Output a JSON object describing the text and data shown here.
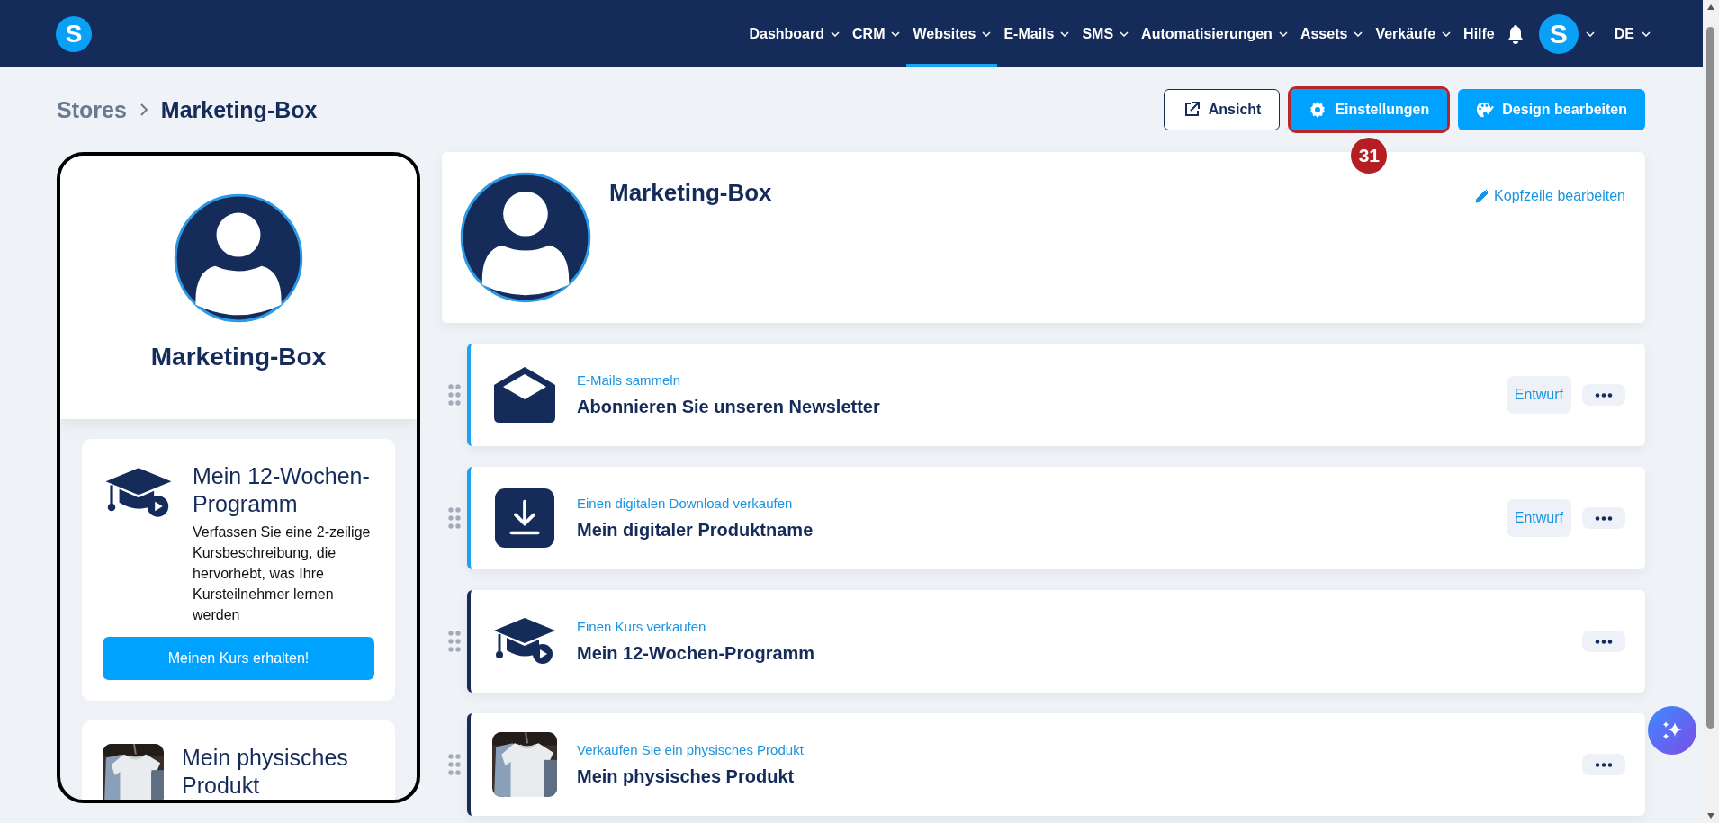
{
  "nav": {
    "logo": "S",
    "items": [
      {
        "label": "Dashboard",
        "dropdown": true,
        "selected": false
      },
      {
        "label": "CRM",
        "dropdown": true,
        "selected": false
      },
      {
        "label": "Websites",
        "dropdown": true,
        "selected": true
      },
      {
        "label": "E-Mails",
        "dropdown": true,
        "selected": false
      },
      {
        "label": "SMS",
        "dropdown": true,
        "selected": false
      },
      {
        "label": "Automatisierungen",
        "dropdown": true,
        "selected": false
      },
      {
        "label": "Assets",
        "dropdown": true,
        "selected": false
      },
      {
        "label": "Verkäufe",
        "dropdown": true,
        "selected": false
      },
      {
        "label": "Hilfe",
        "dropdown": false,
        "selected": false
      }
    ],
    "avatar": "S",
    "language": "DE"
  },
  "breadcrumb": [
    "Stores",
    "Marketing-Box"
  ],
  "actions": [
    {
      "label": "Ansicht",
      "kind": "outline",
      "highlighted": false
    },
    {
      "label": "Einstellungen",
      "kind": "primary",
      "highlighted": true,
      "annotation": "31"
    },
    {
      "label": "Design bearbeiten",
      "kind": "primary",
      "highlighted": false
    }
  ],
  "preview": {
    "title": "Marketing-Box",
    "cards": [
      {
        "kind": "course",
        "title": "Mein 12-Wochen-Programm",
        "description": "Verfassen Sie eine 2-zeilige Kursbeschreibung, die hervorhebt, was Ihre Kursteilnehmer lernen werden",
        "button": "Meinen Kurs erhalten!"
      },
      {
        "kind": "product",
        "title": "Mein physisches Produkt"
      }
    ]
  },
  "header": {
    "title": "Marketing-Box",
    "edit_link": "Kopfzeile bearbeiten"
  },
  "items": [
    {
      "kind": "mail",
      "category": "E-Mails sammeln",
      "title": "Abonnieren Sie unseren Newsletter",
      "badge": "Entwurf"
    },
    {
      "kind": "download",
      "category": "Einen digitalen Download verkaufen",
      "title": "Mein digitaler Produktname",
      "badge": "Entwurf"
    },
    {
      "kind": "course",
      "category": "Einen Kurs verkaufen",
      "title": "Mein 12-Wochen-Programm"
    },
    {
      "kind": "product",
      "category": "Verkaufen Sie ein physisches Produkt",
      "title": "Mein physisches Produkt"
    }
  ]
}
